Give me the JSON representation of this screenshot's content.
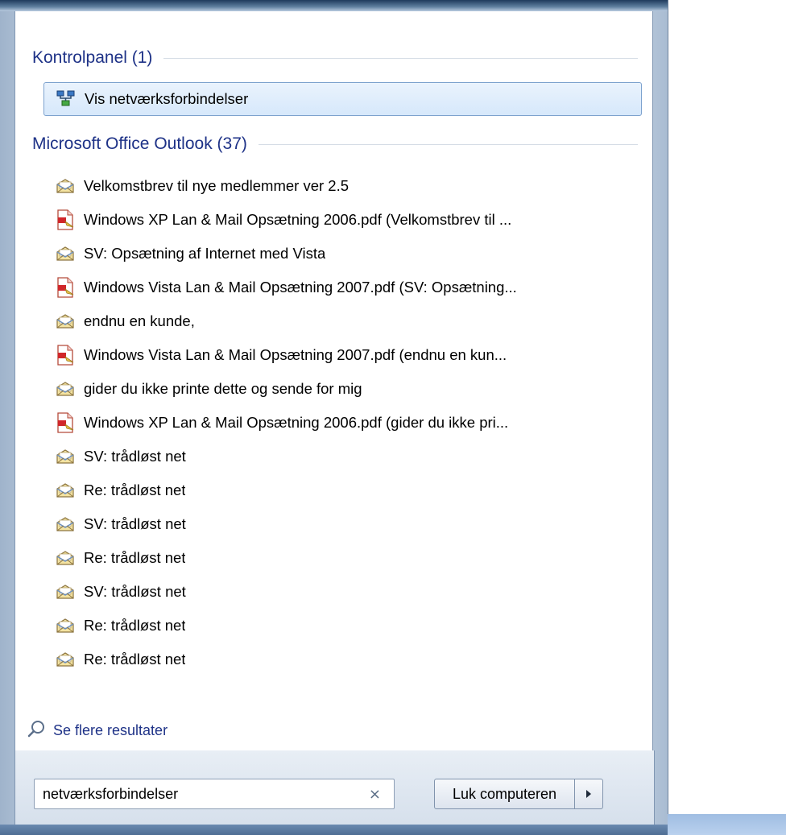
{
  "groups": {
    "control_panel": {
      "title": "Kontrolpanel (1)",
      "items": [
        {
          "label": "Vis netværksforbindelser",
          "icon": "network-connections-icon"
        }
      ]
    },
    "outlook": {
      "title": "Microsoft Office Outlook (37)",
      "items": [
        {
          "label": "Velkomstbrev til nye medlemmer ver 2.5",
          "icon": "envelope-icon"
        },
        {
          "label": "Windows XP Lan & Mail Opsætning 2006.pdf (Velkomstbrev til ...",
          "icon": "pdf-attachment-icon"
        },
        {
          "label": "SV: Opsætning af Internet med Vista",
          "icon": "envelope-icon"
        },
        {
          "label": "Windows Vista Lan & Mail Opsætning 2007.pdf (SV: Opsætning...",
          "icon": "pdf-attachment-icon"
        },
        {
          "label": "endnu en kunde,",
          "icon": "envelope-icon"
        },
        {
          "label": "Windows Vista Lan & Mail Opsætning 2007.pdf (endnu en kun...",
          "icon": "pdf-attachment-icon"
        },
        {
          "label": "gider du ikke printe dette og sende for mig",
          "icon": "envelope-icon"
        },
        {
          "label": "Windows XP Lan & Mail Opsætning 2006.pdf (gider du ikke pri...",
          "icon": "pdf-attachment-icon"
        },
        {
          "label": "SV: trådløst net",
          "icon": "envelope-icon"
        },
        {
          "label": "Re: trådløst net",
          "icon": "envelope-icon"
        },
        {
          "label": "SV: trådløst net",
          "icon": "envelope-icon"
        },
        {
          "label": "Re: trådløst net",
          "icon": "envelope-icon"
        },
        {
          "label": "SV: trådløst net",
          "icon": "envelope-icon"
        },
        {
          "label": "Re: trådløst net",
          "icon": "envelope-icon"
        },
        {
          "label": "Re: trådløst net",
          "icon": "envelope-icon"
        }
      ]
    }
  },
  "see_more": {
    "label": "Se flere resultater",
    "icon": "search-icon"
  },
  "search": {
    "value": "netværksforbindelser",
    "clear_icon": "close-icon",
    "clear_glyph": "×"
  },
  "shutdown": {
    "label": "Luk computeren",
    "arrow_icon": "chevron-right-icon"
  },
  "colors": {
    "header_text": "#1e3287",
    "selection_border": "#7da2ce",
    "selection_fill": "#d6e8fb"
  }
}
